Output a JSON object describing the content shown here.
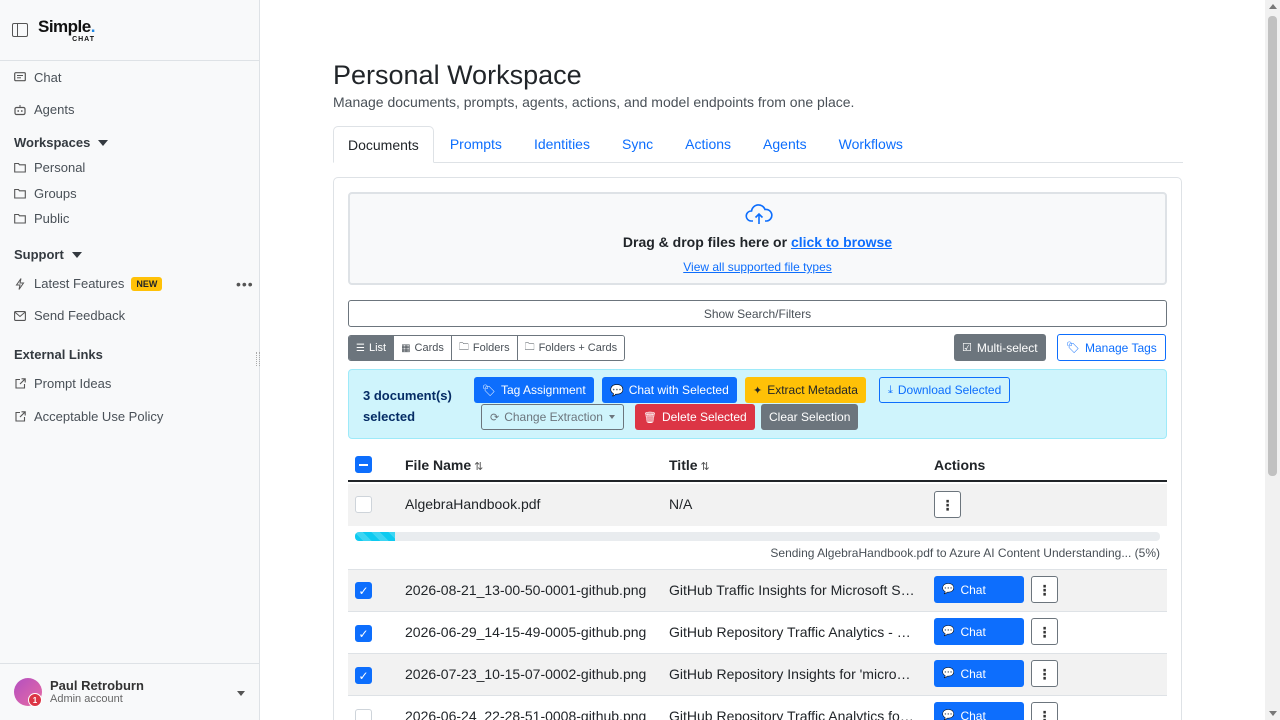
{
  "sidebar": {
    "logo": {
      "main": "Simple",
      "dot": ".",
      "sub": "CHAT"
    },
    "nav": {
      "chat": "Chat",
      "agents": "Agents"
    },
    "workspaces": {
      "label": "Workspaces",
      "items": [
        "Personal",
        "Groups",
        "Public"
      ]
    },
    "support": {
      "label": "Support",
      "latest_features": "Latest Features",
      "new_badge": "NEW",
      "send_feedback": "Send Feedback"
    },
    "external": {
      "label": "External Links",
      "items": [
        "Prompt Ideas",
        "Acceptable Use Policy"
      ]
    },
    "user": {
      "name": "Paul Retroburn",
      "role": "Admin account",
      "badge": "1"
    }
  },
  "page": {
    "title": "Personal Workspace",
    "subtitle": "Manage documents, prompts, agents, actions, and model endpoints from one place.",
    "tabs": [
      "Documents",
      "Prompts",
      "Identities",
      "Sync",
      "Actions",
      "Agents",
      "Workflows"
    ],
    "active_tab": "Documents"
  },
  "upload": {
    "main_text": "Drag & drop files here or ",
    "browse_link": "click to browse",
    "supported_link": "View all supported file types"
  },
  "search_toggle": "Show Search/Filters",
  "view_modes": [
    "List",
    "Cards",
    "Folders",
    "Folders + Cards"
  ],
  "active_view": "List",
  "toolbar": {
    "multi_select": "Multi-select",
    "manage_tags": "Manage Tags"
  },
  "selection": {
    "count_text": "3 document(s) selected",
    "tag_assignment": "Tag Assignment",
    "chat_with_selected": "Chat with Selected",
    "extract_metadata": "Extract Metadata",
    "download_selected": "Download Selected",
    "change_extraction": "Change Extraction",
    "delete_selected": "Delete Selected",
    "clear_selection": "Clear Selection"
  },
  "table": {
    "headers": {
      "file_name": "File Name",
      "title": "Title",
      "actions": "Actions"
    },
    "chat_label": "Chat",
    "processing_row": {
      "file_name": "AlgebraHandbook.pdf",
      "title": "N/A",
      "progress_percent": 5,
      "progress_text": "Sending AlgebraHandbook.pdf to Azure AI Content Understanding... (5%)"
    },
    "rows": [
      {
        "file_name": "2026-08-21_13-00-50-0001-github.png",
        "title": "GitHub Traffic Insights for Microsoft Simple Chat",
        "checked": true
      },
      {
        "file_name": "2026-06-29_14-15-49-0005-github.png",
        "title": "GitHub Repository Traffic Analytics - Microsoft Simple Chat",
        "checked": true
      },
      {
        "file_name": "2026-07-23_10-15-07-0002-github.png",
        "title": "GitHub Repository Insights for 'microsoft/simplechat'",
        "checked": true
      },
      {
        "file_name": "2026-06-24_22-28-51-0008-github.png",
        "title": "GitHub Repository Traffic Analytics for Simple Chat",
        "checked": false
      }
    ]
  },
  "colors": {
    "primary": "#0d6efd",
    "warning": "#ffc107",
    "danger": "#dc3545",
    "secondary": "#6c757d",
    "info_bg": "#cff4fc"
  }
}
